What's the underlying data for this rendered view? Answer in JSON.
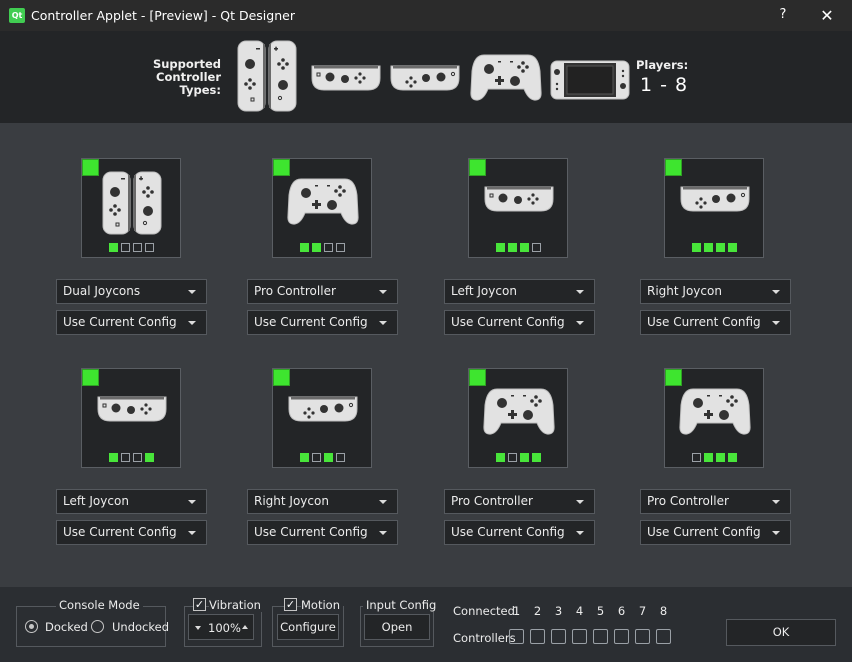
{
  "window": {
    "app_icon_text": "Qt",
    "title": "Controller Applet - [Preview] - Qt Designer",
    "help_label": "?",
    "close_label": "✕"
  },
  "header": {
    "supported_line1": "Supported",
    "supported_line2": "Controller",
    "supported_line3": "Types:",
    "players_label": "Players:",
    "players_range": "1 - 8",
    "types": [
      "dual-joycons",
      "left-joycon",
      "right-joycon",
      "pro-controller",
      "handheld"
    ]
  },
  "players": [
    {
      "controller": "Dual Joycons",
      "config": "Use Current Config",
      "connected": true,
      "leds": [
        1,
        0,
        0,
        0
      ],
      "art": "dual"
    },
    {
      "controller": "Pro Controller",
      "config": "Use Current Config",
      "connected": true,
      "leds": [
        1,
        1,
        0,
        0
      ],
      "art": "pro"
    },
    {
      "controller": "Left Joycon",
      "config": "Use Current Config",
      "connected": true,
      "leds": [
        1,
        1,
        1,
        0
      ],
      "art": "left"
    },
    {
      "controller": "Right Joycon",
      "config": "Use Current Config",
      "connected": true,
      "leds": [
        1,
        1,
        1,
        1
      ],
      "art": "right"
    },
    {
      "controller": "Left Joycon",
      "config": "Use Current Config",
      "connected": true,
      "leds": [
        1,
        0,
        0,
        1
      ],
      "art": "left"
    },
    {
      "controller": "Right Joycon",
      "config": "Use Current Config",
      "connected": true,
      "leds": [
        1,
        0,
        1,
        0
      ],
      "art": "right"
    },
    {
      "controller": "Pro Controller",
      "config": "Use Current Config",
      "connected": true,
      "leds": [
        1,
        0,
        1,
        1
      ],
      "art": "pro"
    },
    {
      "controller": "Pro Controller",
      "config": "Use Current Config",
      "connected": true,
      "leds": [
        0,
        1,
        1,
        1
      ],
      "art": "pro"
    }
  ],
  "bottom": {
    "console_mode_title": "Console Mode",
    "docked_label": "Docked",
    "undocked_label": "Undocked",
    "docked_selected": true,
    "vibration_label": "Vibration",
    "vibration_checked": true,
    "vibration_value": "100%",
    "motion_label": "Motion",
    "motion_checked": true,
    "configure_label": "Configure",
    "input_config_title": "Input Config",
    "open_label": "Open",
    "connected_label": "Connected",
    "controllers_label": "Controllers",
    "player_numbers": [
      "1",
      "2",
      "3",
      "4",
      "5",
      "6",
      "7",
      "8"
    ],
    "ok_label": "OK"
  },
  "colors": {
    "accent_green": "#3ee52f",
    "panel_dark": "#232527",
    "window_bg": "#3a3d41"
  }
}
